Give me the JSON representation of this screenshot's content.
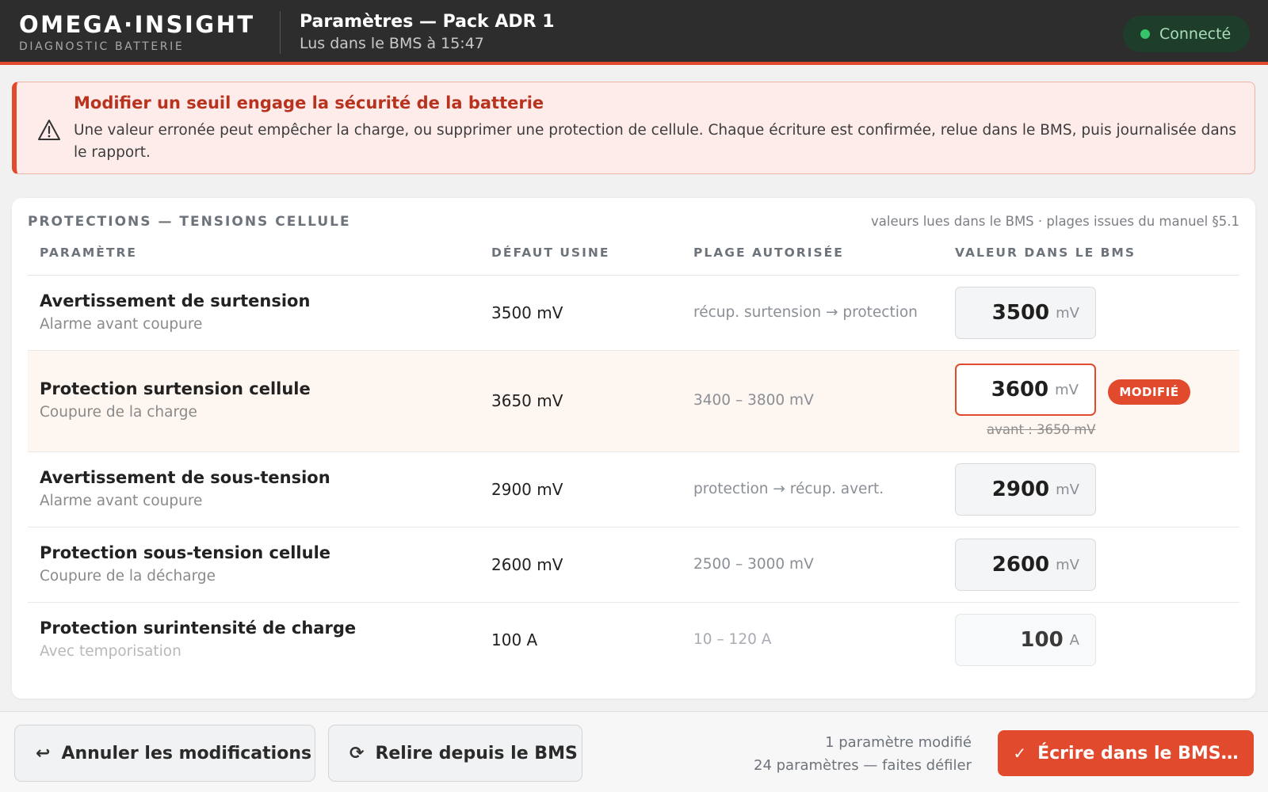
{
  "header": {
    "brand_name": "OMEGA·INSIGHT",
    "brand_sub": "DIAGNOSTIC BATTERIE",
    "title": "Paramètres — Pack ADR 1",
    "subtitle": "Lus dans le BMS à 15:47",
    "status": {
      "label": "Connecté",
      "color": "#35c46a"
    }
  },
  "warning": {
    "icon": "warning-triangle-icon",
    "title": "Modifier un seuil engage la sécurité de la batterie",
    "body": "Une valeur erronée peut empêcher la charge, ou supprimer une protection de cellule. Chaque écriture est confirmée, relue dans le BMS, puis journalisée dans le rapport."
  },
  "section": {
    "title": "PROTECTIONS — TENSIONS CELLULE",
    "note": "valeurs lues dans le BMS · plages issues du manuel §5.1",
    "columns": [
      "PARAMÈTRE",
      "DÉFAUT USINE",
      "PLAGE AUTORISÉE",
      "VALEUR DANS LE BMS"
    ]
  },
  "rows": [
    {
      "name": "Avertissement de surtension",
      "desc": "Alarme avant coupure",
      "default": "3500 mV",
      "range": "récup. surtension → protection",
      "value": "3500",
      "unit": "mV"
    },
    {
      "name": "Protection surtension cellule",
      "desc": "Coupure de la charge",
      "default": "3650 mV",
      "range": "3400 – 3800 mV",
      "value": "3600",
      "unit": "mV",
      "badge": "MODIFIÉ",
      "before": "avant : 3650 mV"
    },
    {
      "name": "Avertissement de sous-tension",
      "desc": "Alarme avant coupure",
      "default": "2900 mV",
      "range": "protection → récup. avert.",
      "value": "2900",
      "unit": "mV"
    },
    {
      "name": "Protection sous-tension cellule",
      "desc": "Coupure de la décharge",
      "default": "2600 mV",
      "range": "2500 – 3000 mV",
      "value": "2600",
      "unit": "mV"
    },
    {
      "name": "Protection surintensité de charge",
      "desc": "Avec temporisation",
      "default": "100 A",
      "range": "10 – 120 A",
      "value": "100",
      "unit": "A"
    }
  ],
  "footer": {
    "undo_label": "Annuler les modifications",
    "reload_label": "Relire depuis le BMS",
    "info_modified": "1 paramètre modifié",
    "info_count": "24 paramètres — faites défiler",
    "write_label": "Écrire dans le BMS…"
  },
  "colors": {
    "accent": "#e24a2d",
    "header_bg": "#2d2d2d",
    "connected": "#35c46a"
  }
}
